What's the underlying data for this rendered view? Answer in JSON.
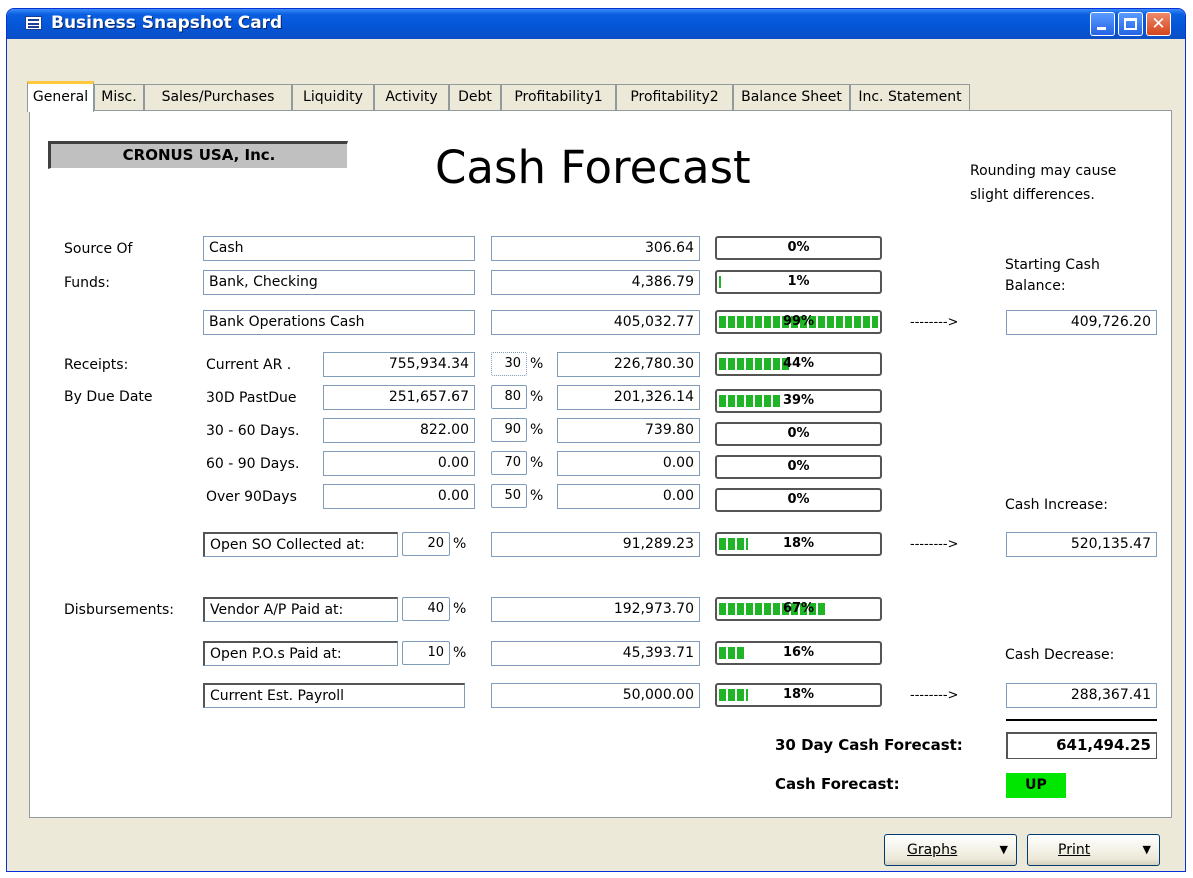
{
  "window": {
    "title": "Business Snapshot Card",
    "close_glyph": "✕",
    "icon": "grid-icon"
  },
  "tabs": [
    {
      "label": "General"
    },
    {
      "label": "Misc."
    },
    {
      "label": "Sales/Purchases"
    },
    {
      "label": "Liquidity"
    },
    {
      "label": "Activity"
    },
    {
      "label": "Debt"
    },
    {
      "label": "Profitability1"
    },
    {
      "label": "Profitability2"
    },
    {
      "label": "Balance Sheet"
    },
    {
      "label": "Inc. Statement"
    }
  ],
  "active_tab": "General",
  "company": "CRONUS USA, Inc.",
  "headline": "Cash Forecast",
  "note": [
    "Rounding may cause",
    "slight differences."
  ],
  "labels": {
    "source_of": "Source Of",
    "funds": "Funds:",
    "receipts": "Receipts:",
    "by_due_date": "By Due Date",
    "disbursements": "Disbursements:",
    "starting_cash_1": "Starting Cash",
    "starting_cash_2": "Balance:",
    "cash_increase": "Cash Increase:",
    "cash_decrease": "Cash Decrease:",
    "forecast_30": "30 Day Cash Forecast:",
    "cash_forecast": "Cash Forecast:",
    "arrow": "-------->",
    "percent": "%"
  },
  "sources": [
    {
      "name": "Cash",
      "amount": "306.64",
      "share": "0%",
      "share_value": 0
    },
    {
      "name": "Bank, Checking",
      "amount": "4,386.79",
      "share": "1%",
      "share_value": 1
    },
    {
      "name": "Bank Operations Cash",
      "amount": "405,032.77",
      "share": "99%",
      "share_value": 99
    }
  ],
  "receipts": [
    {
      "label": "Current AR  .",
      "balance": "755,934.34",
      "pct": "30",
      "amount": "226,780.30",
      "share": "44%",
      "share_value": 44
    },
    {
      "label": "30D PastDue",
      "balance": "251,657.67",
      "pct": "80",
      "amount": "201,326.14",
      "share": "39%",
      "share_value": 39
    },
    {
      "label": "30 - 60 Days.",
      "balance": "822.00",
      "pct": "90",
      "amount": "739.80",
      "share": "0%",
      "share_value": 0
    },
    {
      "label": "60 - 90 Days.",
      "balance": "0.00",
      "pct": "70",
      "amount": "0.00",
      "share": "0%",
      "share_value": 0
    },
    {
      "label": "Over 90Days",
      "balance": "0.00",
      "pct": "50",
      "amount": "0.00",
      "share": "0%",
      "share_value": 0
    }
  ],
  "open_so": {
    "label": "Open SO Collected at:",
    "pct": "20",
    "amount": "91,289.23",
    "share": "18%",
    "share_value": 18
  },
  "disbursements": [
    {
      "label": "Vendor A/P Paid at:",
      "pct": "40",
      "amount": "192,973.70",
      "share": "67%",
      "share_value": 67
    },
    {
      "label": "Open P.O.s Paid at:",
      "pct": "10",
      "amount": "45,393.71",
      "share": "16%",
      "share_value": 16
    },
    {
      "label": "Current Est. Payroll",
      "amount": "50,000.00",
      "share": "18%",
      "share_value": 18
    }
  ],
  "totals": {
    "starting_cash_balance": "409,726.20",
    "cash_increase": "520,135.47",
    "cash_decrease": "288,367.41",
    "forecast_30_day": "641,494.25",
    "forecast_status": "UP",
    "status_color": "#00e600"
  },
  "buttons": {
    "graphs": "Graphs",
    "print": "Print",
    "dropdown_glyph": "▼"
  },
  "colors": {
    "title_bar": "#0455d6",
    "bar_fill": "#1fb526",
    "tab_highlight": "#ffc83c"
  }
}
